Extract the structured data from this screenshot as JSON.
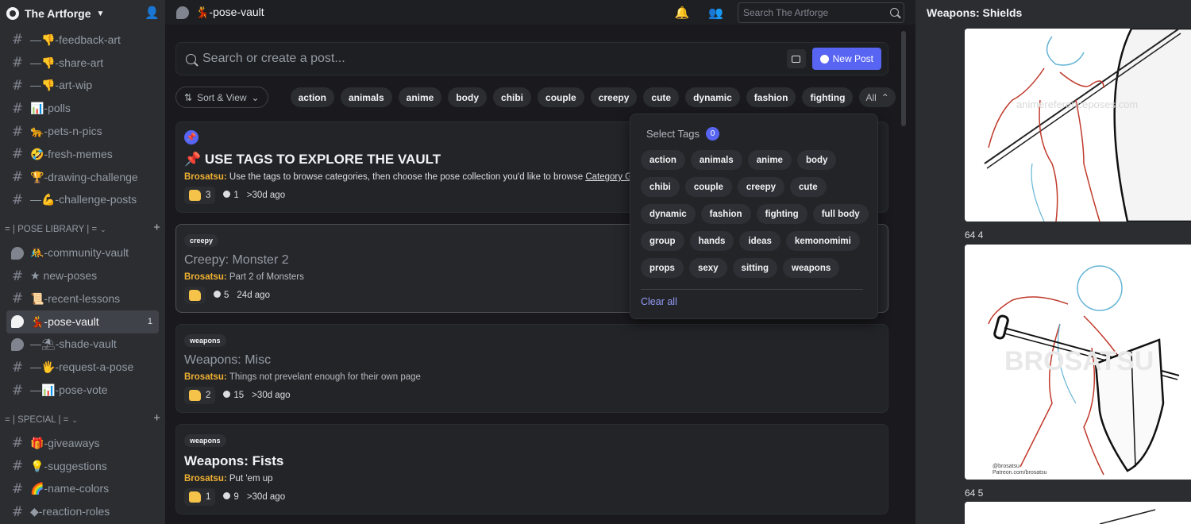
{
  "server": {
    "name": "The Artforge"
  },
  "sidebar": {
    "channels_top": [
      {
        "icon": "hash",
        "label": "—👎-feedback-art"
      },
      {
        "icon": "hash",
        "label": "—👎-share-art"
      },
      {
        "icon": "hash",
        "label": "—👎-art-wip"
      },
      {
        "icon": "hash",
        "label": "📊-polls"
      },
      {
        "icon": "hash",
        "label": "🐆-pets-n-pics"
      },
      {
        "icon": "hash",
        "label": "🤣-fresh-memes"
      },
      {
        "icon": "hash",
        "label": "🏆-drawing-challenge"
      },
      {
        "icon": "hash",
        "label": "—💪-challenge-posts"
      }
    ],
    "category_pose": "= | POSE LIBRARY | =",
    "channels_pose": [
      {
        "icon": "forum",
        "label": "🤼-community-vault"
      },
      {
        "icon": "hash",
        "label": "★ new-poses"
      },
      {
        "icon": "hash",
        "label": "📜-recent-lessons"
      },
      {
        "icon": "forum",
        "label": "💃-pose-vault",
        "active": true,
        "badge": "1"
      },
      {
        "icon": "forum",
        "label": "—⛱-shade-vault"
      },
      {
        "icon": "hash",
        "label": "—🖐-request-a-pose"
      },
      {
        "icon": "hash",
        "label": "—📊-pose-vote"
      }
    ],
    "category_special": "= | SPECIAL | =",
    "channels_special": [
      {
        "icon": "hash",
        "label": "🎁-giveaways"
      },
      {
        "icon": "hash",
        "label": "💡-suggestions"
      },
      {
        "icon": "hash",
        "label": "🌈-name-colors"
      },
      {
        "icon": "hash",
        "label": "◆-reaction-roles"
      }
    ]
  },
  "topbar": {
    "channel": "💃-pose-vault",
    "search_placeholder": "Search The Artforge"
  },
  "forum": {
    "search_placeholder": "Search or create a post...",
    "new_post_label": "New Post",
    "sort_label": "Sort & View",
    "tags": [
      "action",
      "animals",
      "anime",
      "body",
      "chibi",
      "couple",
      "creepy",
      "cute",
      "dynamic",
      "fashion",
      "fighting"
    ],
    "all_label": "All"
  },
  "posts": [
    {
      "pinned": true,
      "tag": "",
      "title": "📌 USE TAGS TO EXPLORE THE VAULT",
      "author": "Brosatsu",
      "body": "Use the tags to browse categories, then choose the pose collection you'd like to browse",
      "link": "Category Gui",
      "reactions": "3",
      "comments": "1",
      "time": ">30d ago"
    },
    {
      "tag": "creepy",
      "title": "Creepy: Monster 2",
      "author": "Brosatsu",
      "body": "Part 2 of Monsters",
      "reactions": "",
      "comments": "5",
      "time": "24d ago"
    },
    {
      "tag": "weapons",
      "title": "Weapons: Misc",
      "author": "Brosatsu",
      "body": "Things not prevelant enough for their own page",
      "reactions": "2",
      "comments": "15",
      "time": ">30d ago"
    },
    {
      "tag": "weapons",
      "title": "Weapons: Fists",
      "author": "Brosatsu",
      "body": "Put 'em up",
      "reactions": "1",
      "comments": "9",
      "time": ">30d ago"
    }
  ],
  "tag_panel": {
    "title": "Select Tags",
    "count": "0",
    "tags": [
      "action",
      "animals",
      "anime",
      "body",
      "chibi",
      "couple",
      "creepy",
      "cute",
      "dynamic",
      "fashion",
      "fighting",
      "full body",
      "group",
      "hands",
      "ideas",
      "kemonomimi",
      "props",
      "sexy",
      "sitting",
      "weapons"
    ],
    "clear_label": "Clear all"
  },
  "thread": {
    "title": "Weapons: Shields",
    "image_labels": [
      "64 4",
      "64 5"
    ],
    "watermark_text": "animereferenceposes.com",
    "credit_lines": [
      "@brosatsu",
      "Patreon.com/brosatsu"
    ]
  },
  "colors": {
    "accent": "#5865f2",
    "author": "#f0b132",
    "link": "#949cf7"
  }
}
